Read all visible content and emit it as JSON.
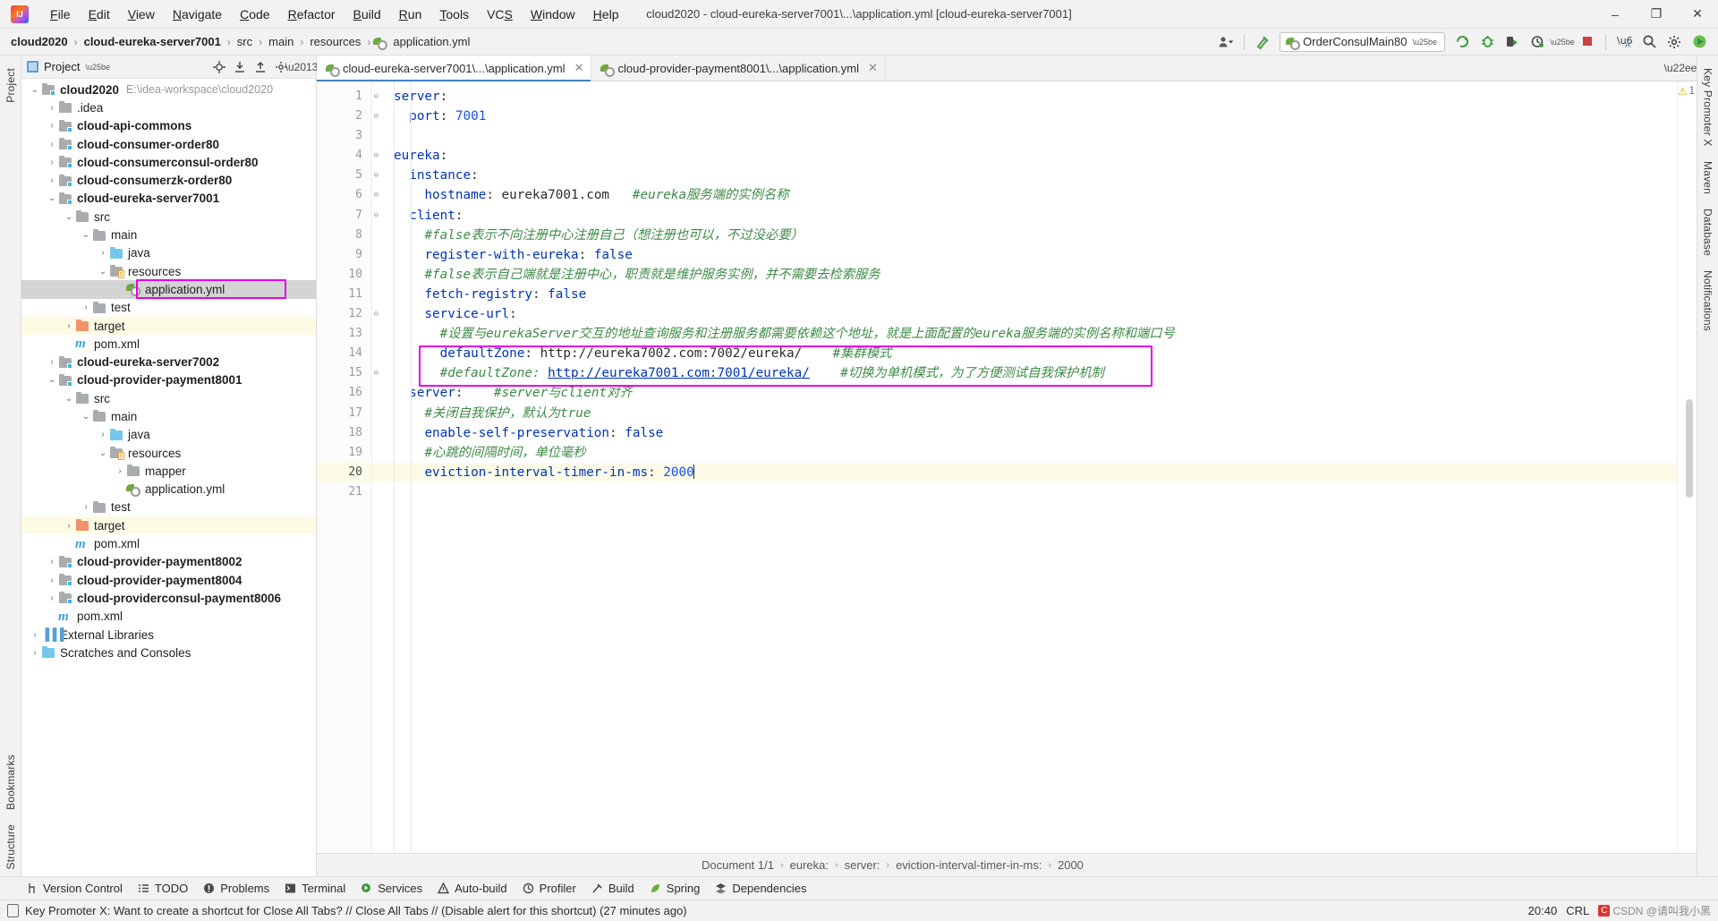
{
  "window": {
    "title": "cloud2020 - cloud-eureka-server7001\\...\\application.yml [cloud-eureka-server7001]",
    "minimize": "–",
    "maximize": "❐",
    "close": "✕"
  },
  "menubar": {
    "items": [
      {
        "label": "File"
      },
      {
        "label": "Edit"
      },
      {
        "label": "View"
      },
      {
        "label": "Navigate"
      },
      {
        "label": "Code"
      },
      {
        "label": "Refactor"
      },
      {
        "label": "Build"
      },
      {
        "label": "Run"
      },
      {
        "label": "Tools"
      },
      {
        "label": "VCS"
      },
      {
        "label": "Window"
      },
      {
        "label": "Help"
      }
    ]
  },
  "navbar": {
    "crumbs": [
      "cloud2020",
      "cloud-eureka-server7001",
      "src",
      "main",
      "resources",
      "application.yml"
    ],
    "separator": "›",
    "run_config": "OrderConsulMain80",
    "icons": [
      "user-settings-icon",
      "hammer-icon",
      "run-icon",
      "debug-icon",
      "run-with-coverage-icon",
      "profile-icon",
      "stop-icon",
      "translate-icon",
      "search-everywhere-icon",
      "settings-icon",
      "ide-icon"
    ]
  },
  "left_strip": {
    "tabs": [
      "Project",
      "Structure",
      "Bookmarks"
    ]
  },
  "right_strip": {
    "tabs": [
      "Key Promoter X",
      "Maven",
      "Database",
      "Notifications"
    ]
  },
  "project_panel": {
    "title": "Project",
    "header_icons": [
      "locate-icon",
      "collapse-all-icon",
      "expand-all-icon",
      "gear-icon",
      "hide-icon"
    ],
    "tree": [
      {
        "depth": 0,
        "arrow": "⌄",
        "icon": "module",
        "name": "cloud2020",
        "bold": true,
        "path": "E:\\idea-workspace\\cloud2020"
      },
      {
        "depth": 1,
        "arrow": "›",
        "icon": "folder",
        "name": ".idea",
        "bold": false
      },
      {
        "depth": 1,
        "arrow": "›",
        "icon": "module",
        "name": "cloud-api-commons",
        "bold": true
      },
      {
        "depth": 1,
        "arrow": "›",
        "icon": "module",
        "name": "cloud-consumer-order80",
        "bold": true
      },
      {
        "depth": 1,
        "arrow": "›",
        "icon": "module",
        "name": "cloud-consumerconsul-order80",
        "bold": true
      },
      {
        "depth": 1,
        "arrow": "›",
        "icon": "module",
        "name": "cloud-consumerzk-order80",
        "bold": true
      },
      {
        "depth": 1,
        "arrow": "⌄",
        "icon": "module",
        "name": "cloud-eureka-server7001",
        "bold": true
      },
      {
        "depth": 2,
        "arrow": "⌄",
        "icon": "folder",
        "name": "src",
        "bold": false
      },
      {
        "depth": 3,
        "arrow": "⌄",
        "icon": "folder",
        "name": "main",
        "bold": false
      },
      {
        "depth": 4,
        "arrow": "›",
        "icon": "folder-blue",
        "name": "java",
        "bold": false
      },
      {
        "depth": 4,
        "arrow": "⌄",
        "icon": "folder-res",
        "name": "resources",
        "bold": false
      },
      {
        "depth": 5,
        "arrow": "",
        "icon": "yml",
        "name": "application.yml",
        "bold": false,
        "selected": true,
        "highlighted": true
      },
      {
        "depth": 3,
        "arrow": "›",
        "icon": "folder",
        "name": "test",
        "bold": false
      },
      {
        "depth": 2,
        "arrow": "›",
        "icon": "folder-orange",
        "name": "target",
        "bold": false,
        "excluded": true
      },
      {
        "depth": 2,
        "arrow": "",
        "icon": "maven",
        "name": "pom.xml",
        "bold": false
      },
      {
        "depth": 1,
        "arrow": "›",
        "icon": "module",
        "name": "cloud-eureka-server7002",
        "bold": true
      },
      {
        "depth": 1,
        "arrow": "⌄",
        "icon": "module",
        "name": "cloud-provider-payment8001",
        "bold": true
      },
      {
        "depth": 2,
        "arrow": "⌄",
        "icon": "folder",
        "name": "src",
        "bold": false
      },
      {
        "depth": 3,
        "arrow": "⌄",
        "icon": "folder",
        "name": "main",
        "bold": false
      },
      {
        "depth": 4,
        "arrow": "›",
        "icon": "folder-blue",
        "name": "java",
        "bold": false
      },
      {
        "depth": 4,
        "arrow": "⌄",
        "icon": "folder-res",
        "name": "resources",
        "bold": false
      },
      {
        "depth": 5,
        "arrow": "›",
        "icon": "folder",
        "name": "mapper",
        "bold": false
      },
      {
        "depth": 5,
        "arrow": "",
        "icon": "yml",
        "name": "application.yml",
        "bold": false
      },
      {
        "depth": 3,
        "arrow": "›",
        "icon": "folder",
        "name": "test",
        "bold": false
      },
      {
        "depth": 2,
        "arrow": "›",
        "icon": "folder-orange",
        "name": "target",
        "bold": false,
        "excluded": true
      },
      {
        "depth": 2,
        "arrow": "",
        "icon": "maven",
        "name": "pom.xml",
        "bold": false
      },
      {
        "depth": 1,
        "arrow": "›",
        "icon": "module",
        "name": "cloud-provider-payment8002",
        "bold": true
      },
      {
        "depth": 1,
        "arrow": "›",
        "icon": "module",
        "name": "cloud-provider-payment8004",
        "bold": true
      },
      {
        "depth": 1,
        "arrow": "›",
        "icon": "module",
        "name": "cloud-providerconsul-payment8006",
        "bold": true
      },
      {
        "depth": 1,
        "arrow": "",
        "icon": "maven",
        "name": "pom.xml",
        "bold": false
      },
      {
        "depth": 0,
        "arrow": "›",
        "icon": "library",
        "name": "External Libraries",
        "bold": false
      },
      {
        "depth": 0,
        "arrow": "›",
        "icon": "scratch",
        "name": "Scratches and Consoles",
        "bold": false
      }
    ]
  },
  "editor": {
    "tabs": [
      {
        "label": "cloud-eureka-server7001\\...\\application.yml",
        "active": true,
        "close": "✕"
      },
      {
        "label": "cloud-provider-payment8001\\...\\application.yml",
        "active": false,
        "close": "✕"
      }
    ],
    "warning_count": "1",
    "warning_icon": "⚠",
    "lines": [
      {
        "n": 1,
        "fold": "⊖",
        "tokens": [
          {
            "t": "server",
            "c": "k"
          },
          {
            "t": ":",
            "c": "plain"
          }
        ]
      },
      {
        "n": 2,
        "fold": "⊖",
        "tokens": [
          {
            "t": "  ",
            "c": "plain"
          },
          {
            "t": "port",
            "c": "k"
          },
          {
            "t": ": ",
            "c": "plain"
          },
          {
            "t": "7001",
            "c": "num"
          }
        ]
      },
      {
        "n": 3,
        "fold": "",
        "tokens": []
      },
      {
        "n": 4,
        "fold": "⊖",
        "tokens": [
          {
            "t": "eureka",
            "c": "k"
          },
          {
            "t": ":",
            "c": "plain"
          }
        ]
      },
      {
        "n": 5,
        "fold": "⊖",
        "tokens": [
          {
            "t": "  ",
            "c": "plain"
          },
          {
            "t": "instance",
            "c": "k"
          },
          {
            "t": ":",
            "c": "plain"
          }
        ]
      },
      {
        "n": 6,
        "fold": "⊖",
        "tokens": [
          {
            "t": "    ",
            "c": "plain"
          },
          {
            "t": "hostname",
            "c": "k"
          },
          {
            "t": ": ",
            "c": "plain"
          },
          {
            "t": "eureka7001.com",
            "c": "plain"
          },
          {
            "t": "   ",
            "c": "plain"
          },
          {
            "t": "#eureka服务端的实例名称",
            "c": "cm"
          }
        ]
      },
      {
        "n": 7,
        "fold": "⊖",
        "tokens": [
          {
            "t": "  ",
            "c": "plain"
          },
          {
            "t": "client",
            "c": "k"
          },
          {
            "t": ":",
            "c": "plain"
          }
        ]
      },
      {
        "n": 8,
        "fold": "",
        "tokens": [
          {
            "t": "    ",
            "c": "plain"
          },
          {
            "t": "#false表示不向注册中心注册自己（想注册也可以，不过没必要）",
            "c": "cm"
          }
        ]
      },
      {
        "n": 9,
        "fold": "",
        "tokens": [
          {
            "t": "    ",
            "c": "plain"
          },
          {
            "t": "register-with-eureka",
            "c": "k"
          },
          {
            "t": ": ",
            "c": "plain"
          },
          {
            "t": "false",
            "c": "v"
          }
        ]
      },
      {
        "n": 10,
        "fold": "",
        "tokens": [
          {
            "t": "    ",
            "c": "plain"
          },
          {
            "t": "#false表示自己端就是注册中心，职责就是维护服务实例，并不需要去检索服务",
            "c": "cm"
          }
        ]
      },
      {
        "n": 11,
        "fold": "",
        "tokens": [
          {
            "t": "    ",
            "c": "plain"
          },
          {
            "t": "fetch-registry",
            "c": "k"
          },
          {
            "t": ": ",
            "c": "plain"
          },
          {
            "t": "false",
            "c": "v"
          }
        ]
      },
      {
        "n": 12,
        "fold": "⊖",
        "tokens": [
          {
            "t": "    ",
            "c": "plain"
          },
          {
            "t": "service-url",
            "c": "k"
          },
          {
            "t": ":",
            "c": "plain"
          }
        ]
      },
      {
        "n": 13,
        "fold": "",
        "tokens": [
          {
            "t": "      ",
            "c": "plain"
          },
          {
            "t": "#设置与eurekaServer交互的地址查询服务和注册服务都需要依赖这个地址，就是上面配置的eureka服务端的实例名称和端口号",
            "c": "cm"
          }
        ]
      },
      {
        "n": 14,
        "fold": "",
        "tokens": [
          {
            "t": "      ",
            "c": "plain"
          },
          {
            "t": "defaultZone",
            "c": "k"
          },
          {
            "t": ": ",
            "c": "plain"
          },
          {
            "t": "http://eureka7002.com:7002/eureka/",
            "c": "plain"
          },
          {
            "t": "    ",
            "c": "plain"
          },
          {
            "t": "#集群模式",
            "c": "cm"
          }
        ]
      },
      {
        "n": 15,
        "fold": "⊖",
        "tokens": [
          {
            "t": "      ",
            "c": "plain"
          },
          {
            "t": "#defaultZone: ",
            "c": "cm"
          },
          {
            "t": "http://eureka7001.com:7001/eureka/",
            "c": "lnk"
          },
          {
            "t": "    ",
            "c": "plain"
          },
          {
            "t": "#切换为单机模式，为了方便测试自我保护机制",
            "c": "cm"
          }
        ]
      },
      {
        "n": 16,
        "fold": "",
        "tokens": [
          {
            "t": "  ",
            "c": "plain"
          },
          {
            "t": "server",
            "c": "k"
          },
          {
            "t": ":",
            "c": "plain"
          },
          {
            "t": "    ",
            "c": "plain"
          },
          {
            "t": "#server与client对齐",
            "c": "cm"
          }
        ]
      },
      {
        "n": 17,
        "fold": "",
        "tokens": [
          {
            "t": "    ",
            "c": "plain"
          },
          {
            "t": "#关闭自我保护，默认为true",
            "c": "cm"
          }
        ]
      },
      {
        "n": 18,
        "fold": "",
        "tokens": [
          {
            "t": "    ",
            "c": "plain"
          },
          {
            "t": "enable-self-preservation",
            "c": "k"
          },
          {
            "t": ": ",
            "c": "plain"
          },
          {
            "t": "false",
            "c": "v"
          }
        ]
      },
      {
        "n": 19,
        "fold": "",
        "tokens": [
          {
            "t": "    ",
            "c": "plain"
          },
          {
            "t": "#心跳的间隔时间，单位毫秒",
            "c": "cm"
          }
        ]
      },
      {
        "n": 20,
        "fold": "⊖",
        "tokens": [
          {
            "t": "    ",
            "c": "plain"
          },
          {
            "t": "eviction-interval-timer-in-ms",
            "c": "k"
          },
          {
            "t": ": ",
            "c": "plain"
          },
          {
            "t": "2000",
            "c": "num"
          }
        ],
        "current": true,
        "caret": true
      },
      {
        "n": 21,
        "fold": "",
        "tokens": []
      }
    ]
  },
  "doc_status": {
    "document": "Document 1/1",
    "crumbs": [
      "eureka:",
      "server:",
      "eviction-interval-timer-in-ms:",
      "2000"
    ],
    "separator": "›"
  },
  "tool_windows": {
    "items": [
      {
        "label": "Version Control",
        "icon": "branch-icon"
      },
      {
        "label": "TODO",
        "icon": "list-icon"
      },
      {
        "label": "Problems",
        "icon": "error-icon"
      },
      {
        "label": "Terminal",
        "icon": "terminal-icon"
      },
      {
        "label": "Services",
        "icon": "services-icon"
      },
      {
        "label": "Auto-build",
        "icon": "warning-icon"
      },
      {
        "label": "Profiler",
        "icon": "profiler-icon"
      },
      {
        "label": "Build",
        "icon": "hammer-icon"
      },
      {
        "label": "Spring",
        "icon": "spring-leaf-icon"
      },
      {
        "label": "Dependencies",
        "icon": "dependencies-icon"
      }
    ]
  },
  "statusbar": {
    "message": "Key Promoter X: Want to create a shortcut for Close All Tabs? // Close All Tabs // (Disable alert for this shortcut) (27 minutes ago)",
    "time": "20:40",
    "encoding": "CRL",
    "watermark": "CSDN @请叫我小黑"
  },
  "colors": {
    "accent": "#4083c9",
    "highlight_box": "#e800e8",
    "comment": "#3d8b46",
    "keyword": "#0033b3",
    "number": "#1750eb"
  }
}
